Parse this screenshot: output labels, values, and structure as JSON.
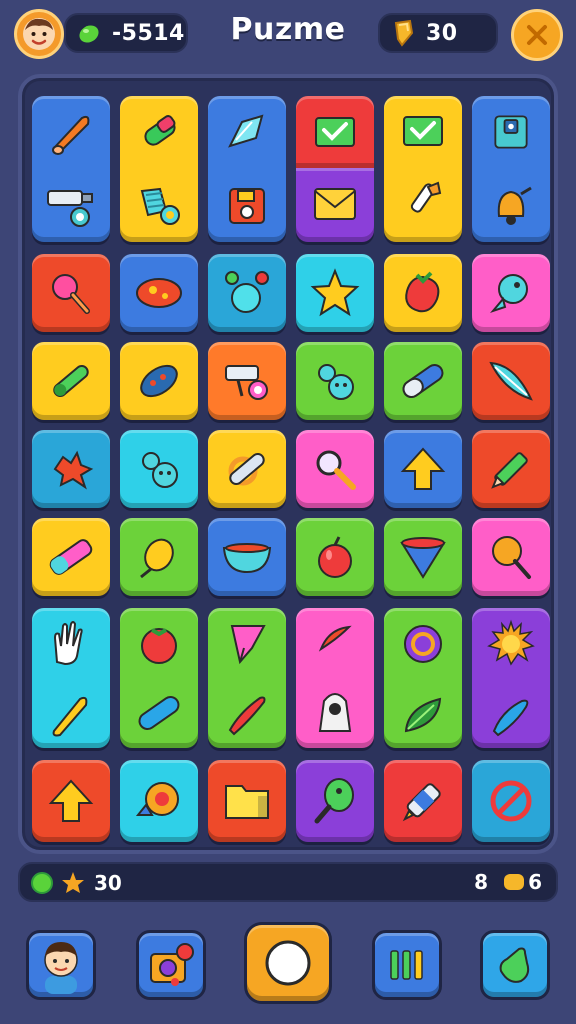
{
  "header": {
    "title": "Puzme",
    "gems_value": "-5514",
    "coins_value": "30"
  },
  "status": {
    "stars_value": "30",
    "right_count": "8",
    "right_coins": "6"
  },
  "colors": {
    "background": "#3d4576",
    "board": "#2c335c",
    "accent": "#f6a623"
  },
  "board": {
    "tiles": [
      {
        "color": "#3d7be0",
        "icons": [
          "carrot-icon",
          "camera-icon"
        ]
      },
      {
        "color": "#ffcc1f",
        "icons": [
          "tube-icon",
          "towel-icon"
        ]
      },
      {
        "color": "#3d7be0",
        "icons": [
          "crystal-icon",
          "floppy-disk-icon"
        ]
      },
      {
        "color": "#ee3b3b",
        "icons": [
          "mail-check-icon"
        ]
      },
      {
        "color": "#8b3fd9",
        "icons": [
          "envelope-icon"
        ]
      },
      {
        "color": "#ffcc1f",
        "icons": [
          "mail-check-icon",
          "brush-icon"
        ]
      },
      {
        "color": "#3d7be0",
        "icons": [
          "floppy-disk-icon",
          "bell-icon"
        ]
      },
      {
        "color": "#ee4a2a",
        "icons": [
          "flower-icon"
        ]
      },
      {
        "color": "#3d7be0",
        "icons": [
          "fish-icon"
        ]
      },
      {
        "color": "#2aa6d8",
        "icons": [
          "bubbles-icon"
        ]
      },
      {
        "color": "#2fd0e8",
        "icons": [
          "star-icon"
        ]
      },
      {
        "color": "#ffcc1f",
        "icons": [
          "strawberry-icon"
        ]
      },
      {
        "color": "#ff5ec8",
        "icons": [
          "fish-icon"
        ]
      },
      {
        "color": "#ffcc1f",
        "icons": [
          "pencil-icon"
        ]
      },
      {
        "color": "#ffcc1f",
        "icons": [
          "bug-icon"
        ]
      },
      {
        "color": "#ff7a2a",
        "icons": [
          "camera-icon"
        ]
      },
      {
        "color": "#6cd23a",
        "icons": [
          "bugs-icon"
        ]
      },
      {
        "color": "#6cd23a",
        "icons": [
          "capsule-icon"
        ]
      },
      {
        "color": "#ee4a2a",
        "icons": [
          "feather-icon"
        ]
      },
      {
        "color": "#2aa6d8",
        "icons": [
          "splash-icon"
        ]
      },
      {
        "color": "#2fd0e8",
        "icons": [
          "bugs-icon"
        ]
      },
      {
        "color": "#ffcc1f",
        "icons": [
          "bandage-icon"
        ]
      },
      {
        "color": "#ff5ec8",
        "icons": [
          "magnifier-icon"
        ]
      },
      {
        "color": "#3d7be0",
        "icons": [
          "up-arrow-icon"
        ]
      },
      {
        "color": "#ee4a2a",
        "icons": [
          "pencil-icon"
        ]
      },
      {
        "color": "#ffcc1f",
        "icons": [
          "eraser-icon"
        ]
      },
      {
        "color": "#6cd23a",
        "icons": [
          "lemon-icon"
        ]
      },
      {
        "color": "#3d7be0",
        "icons": [
          "bowl-icon"
        ]
      },
      {
        "color": "#6cd23a",
        "icons": [
          "apple-icon"
        ]
      },
      {
        "color": "#6cd23a",
        "icons": [
          "cone-icon"
        ]
      },
      {
        "color": "#ff5ec8",
        "icons": [
          "lollipop-icon"
        ]
      },
      {
        "color": "#2fd0e8",
        "icons": [
          "glove-icon",
          "carrot-icon"
        ]
      },
      {
        "color": "#6cd23a",
        "icons": [
          "tomato-icon",
          "capsule-icon"
        ]
      },
      {
        "color": "#6cd23a",
        "icons": [
          "gem-icon",
          "chili-icon"
        ]
      },
      {
        "color": "#ff5ec8",
        "icons": [
          "swirl-icon",
          "robot-icon"
        ]
      },
      {
        "color": "#6cd23a",
        "icons": [
          "swirl-icon",
          "leaf-icon"
        ]
      },
      {
        "color": "#8b3fd9",
        "icons": [
          "sun-icon",
          "pepper-icon"
        ]
      },
      {
        "color": "#ee4a2a",
        "icons": [
          "up-arrow-icon"
        ]
      },
      {
        "color": "#2fd0e8",
        "icons": [
          "snail-icon"
        ]
      },
      {
        "color": "#ee4a2a",
        "icons": [
          "folder-icon"
        ]
      },
      {
        "color": "#8b3fd9",
        "icons": [
          "racket-icon"
        ]
      },
      {
        "color": "#ee3b3b",
        "icons": [
          "marker-icon"
        ]
      },
      {
        "color": "#2aa6d8",
        "icons": [
          "no-entry-icon"
        ]
      }
    ]
  },
  "nav": [
    {
      "name": "profile-nav-button",
      "icon": "avatar-icon",
      "color": "#3d7be0"
    },
    {
      "name": "camera-nav-button",
      "icon": "camera-icon",
      "color": "#3d7be0"
    },
    {
      "name": "play-nav-button",
      "icon": "circle-icon",
      "color": "#f6a623"
    },
    {
      "name": "levels-nav-button",
      "icon": "bars-icon",
      "color": "#3d7be0"
    },
    {
      "name": "boost-nav-button",
      "icon": "bottle-icon",
      "color": "#2fa6e8"
    }
  ]
}
